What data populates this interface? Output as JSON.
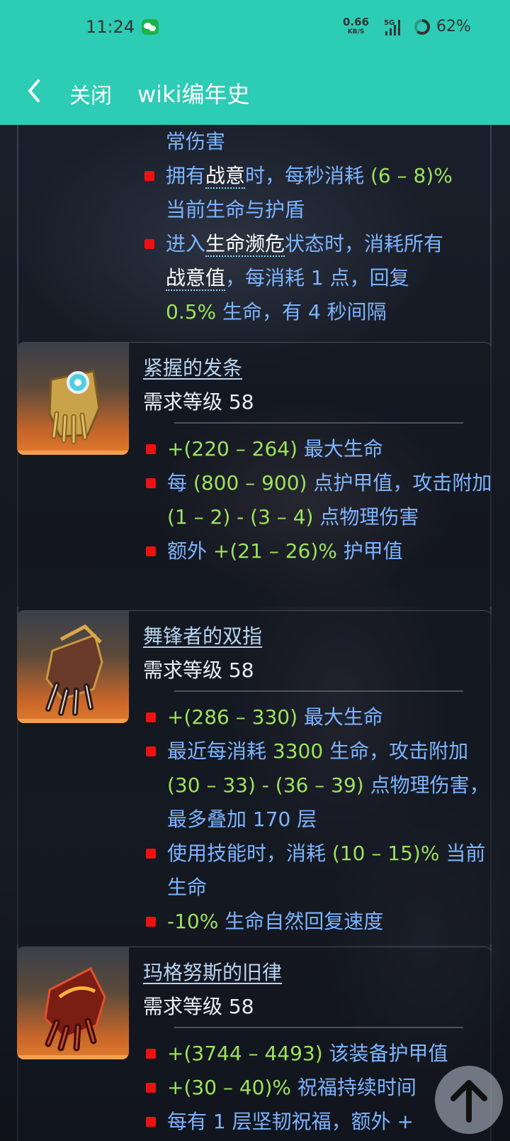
{
  "status_bar": {
    "time": "11:24",
    "net_speed": "0.66",
    "net_unit": "KB/S",
    "network_type": "5G",
    "battery": "62%",
    "icons": [
      "wechat-icon",
      "signal-icon",
      "battery-icon"
    ]
  },
  "app_bar": {
    "back_icon": "chevron-left-icon",
    "close_label": "关闭",
    "title": "wiki编年史"
  },
  "top_fragment": {
    "lead_text": "常伤害",
    "mods": [
      {
        "parts": [
          {
            "t": "拥有"
          },
          {
            "t": "战意",
            "kw": true
          },
          {
            "t": "时，每秒消耗 "
          },
          {
            "t": "(6 – 8)%",
            "g": true
          },
          {
            "t": " 当前生命与护盾"
          }
        ]
      },
      {
        "parts": [
          {
            "t": "进入"
          },
          {
            "t": "生命濒危",
            "kw": true
          },
          {
            "t": "状态时，消耗所有"
          },
          {
            "t": "战意值",
            "kw": true
          },
          {
            "t": "，每消耗 1 点，回复 "
          },
          {
            "t": "0.5%",
            "g": true
          },
          {
            "t": " 生命，有 4 秒间隔"
          }
        ]
      }
    ]
  },
  "items": [
    {
      "name": "紧握的发条",
      "level": "需求等级 58",
      "mods": [
        {
          "parts": [
            {
              "t": "+(220 – 264)",
              "g": true
            },
            {
              "t": " 最大生命"
            }
          ]
        },
        {
          "parts": [
            {
              "t": "每 "
            },
            {
              "t": "(800 – 900)",
              "g": true
            },
            {
              "t": " 点护甲值，攻击附加 "
            },
            {
              "t": "(1 – 2) - (3 – 4)",
              "g": true
            },
            {
              "t": " 点物理伤害"
            }
          ]
        },
        {
          "parts": [
            {
              "t": "额外 "
            },
            {
              "t": "+(21 – 26)%",
              "g": true
            },
            {
              "t": " 护甲值"
            }
          ]
        }
      ]
    },
    {
      "name": "舞锋者的双指",
      "level": "需求等级 58",
      "mods": [
        {
          "parts": [
            {
              "t": "+(286 – 330)",
              "g": true
            },
            {
              "t": " 最大生命"
            }
          ]
        },
        {
          "parts": [
            {
              "t": "最近每消耗 "
            },
            {
              "t": "3300",
              "g": true
            },
            {
              "t": " 生命，攻击附加 "
            },
            {
              "t": "(30 – 33) - (36 – 39)",
              "g": true
            },
            {
              "t": " 点物理伤害，最多叠加 170 层"
            }
          ]
        },
        {
          "parts": [
            {
              "t": "使用技能时，消耗 "
            },
            {
              "t": "(10 – 15)%",
              "g": true
            },
            {
              "t": " 当前生命"
            }
          ]
        },
        {
          "parts": [
            {
              "t": "-10%",
              "g": true
            },
            {
              "t": " 生命自然回复速度"
            }
          ]
        }
      ]
    },
    {
      "name": "玛格努斯的旧律",
      "level": "需求等级 58",
      "mods": [
        {
          "parts": [
            {
              "t": "+(3744 – 4493)",
              "g": true
            },
            {
              "t": " 该装备护甲值"
            }
          ]
        },
        {
          "parts": [
            {
              "t": "+(30 – 40)%",
              "g": true
            },
            {
              "t": " 祝福持续时间"
            }
          ]
        },
        {
          "parts": [
            {
              "t": "每有 1 层坚韧祝福，额外 +"
            }
          ]
        }
      ]
    }
  ],
  "fab": {
    "icon": "arrow-up-icon"
  }
}
